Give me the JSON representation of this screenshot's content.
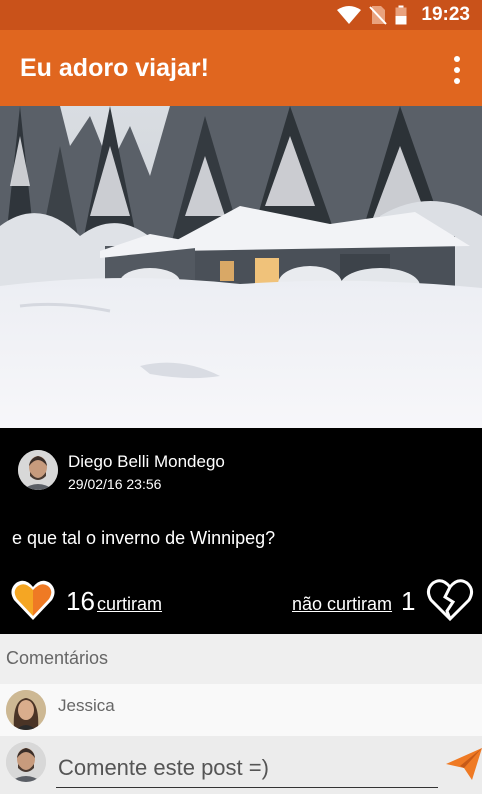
{
  "status_bar": {
    "time": "19:23"
  },
  "app_bar": {
    "title": "Eu adoro viajar!"
  },
  "post": {
    "author": "Diego Belli Mondego",
    "date": "29/02/16 23:56",
    "text": "e que tal o inverno de Winnipeg?",
    "likes": {
      "count": "16",
      "label": "curtiram"
    },
    "dislikes": {
      "count": "1",
      "label": "não curtiram"
    }
  },
  "comments": {
    "header": "Comentários",
    "items": [
      {
        "author": "Jessica"
      }
    ]
  },
  "compose": {
    "placeholder": "Comente este post =)"
  },
  "colors": {
    "status_bar": "#c9521a",
    "app_bar": "#e0661f",
    "accent": "#ef7a24",
    "post_bg": "#000000"
  }
}
